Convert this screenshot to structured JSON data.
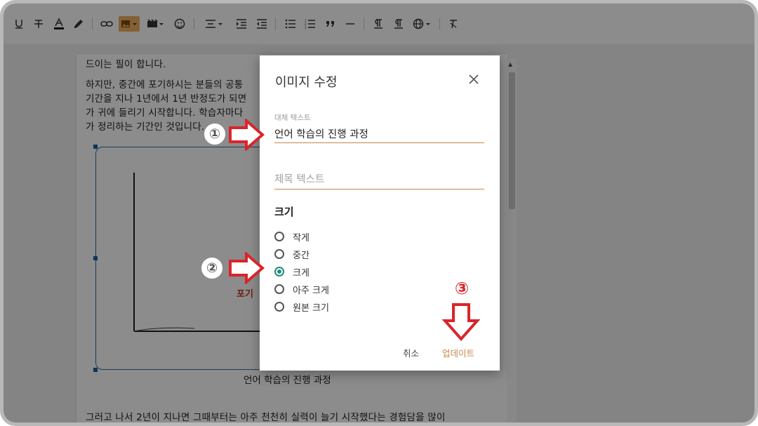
{
  "document": {
    "lines": [
      "드이는 필이 합니다.",
      "하지만, 중간에 포기하시는 분들의 공통",
      "기간을 지나 1년에서 1년 반정도가 되면",
      "가 귀에 들리기 시작합니다. 학습자마다",
      "가 정리하는 기간인 것입니다.",
      "그러고 나서 2년이 지나면 그때부터는 아주 천천히 실력이 늘기 시작했다는 경험담을 많이"
    ],
    "image_caption": "언어 학습의 진행 과정",
    "image_inner_text": "포기"
  },
  "dialog": {
    "title": "이미지 수정",
    "alt_label": "대체 텍스트",
    "alt_value": "언어 학습의 진행 과정",
    "title_placeholder": "제목 텍스트",
    "size_heading": "크기",
    "size_options": [
      "작게",
      "중간",
      "크게",
      "아주 크게",
      "원본 크기"
    ],
    "selected_size": "크게",
    "cancel_label": "취소",
    "update_label": "업데이트"
  },
  "annotations": {
    "step1": "①",
    "step2": "②",
    "step3": "③"
  },
  "colors": {
    "accent": "#c9864a",
    "radio_selected": "#1f8a79",
    "arrow_red": "#d9252a"
  }
}
